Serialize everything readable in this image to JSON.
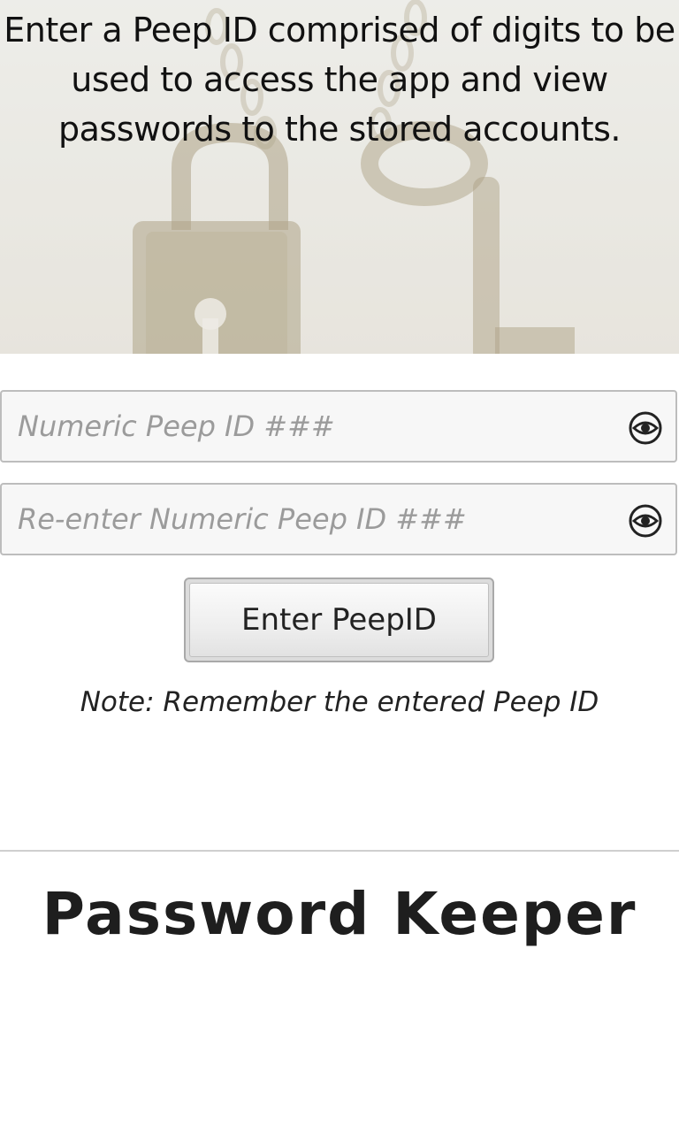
{
  "hero": {
    "message_line1": "Enter a Peep ID comprised of digits to be",
    "message_line2": "used to access the app and view",
    "message_line3": "passwords to the stored accounts.",
    "image_subject": "padlock and key pendants"
  },
  "form": {
    "peep_id": {
      "placeholder": "Numeric Peep ID ###",
      "value": "",
      "toggle_icon": "eye-icon"
    },
    "peep_id_confirm": {
      "placeholder": "Re-enter Numeric Peep ID ###",
      "value": "",
      "toggle_icon": "eye-icon"
    },
    "submit_label": "Enter PeepID",
    "note": "Note: Remember the entered Peep ID"
  },
  "footer": {
    "brand": "Password Keeper"
  },
  "colors": {
    "background": "#ffffff",
    "text": "#111111",
    "field_border": "#bdbdbd",
    "placeholder": "#9b9b9b",
    "brand_text": "#1e1e1e"
  }
}
